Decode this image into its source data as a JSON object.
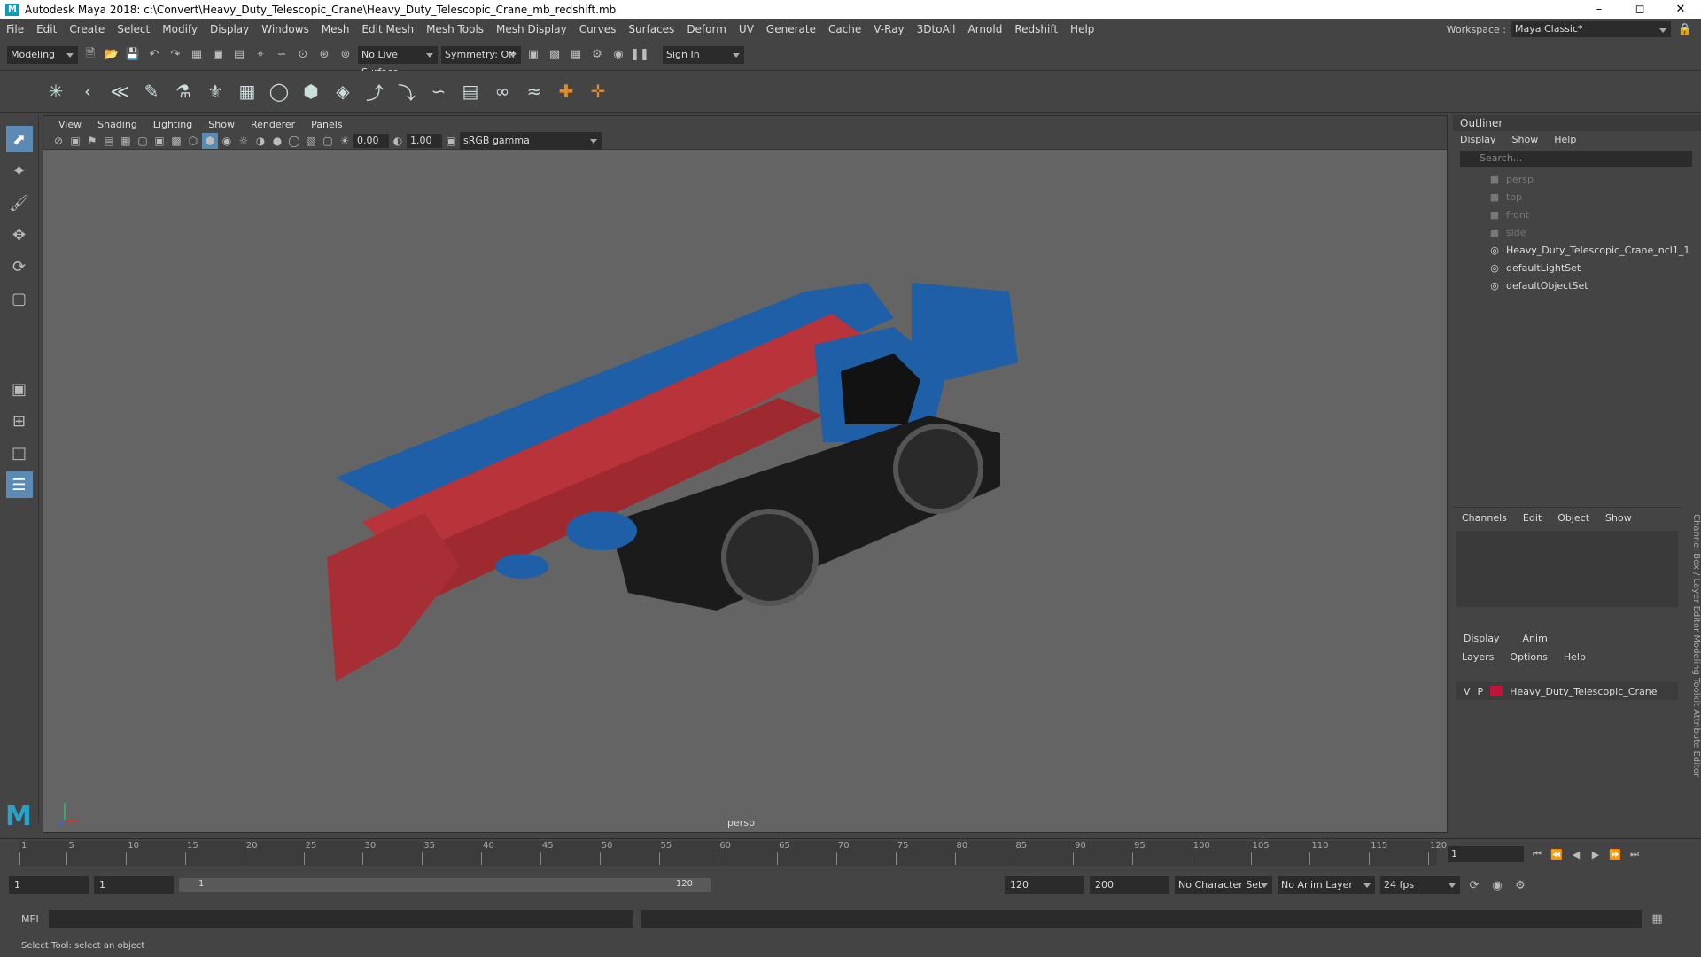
{
  "titlebar": {
    "title": "Autodesk Maya 2018: c:\\Convert\\Heavy_Duty_Telescopic_Crane\\Heavy_Duty_Telescopic_Crane_mb_redshift.mb"
  },
  "menus": [
    "File",
    "Edit",
    "Create",
    "Select",
    "Modify",
    "Display",
    "Windows",
    "Mesh",
    "Edit Mesh",
    "Mesh Tools",
    "Mesh Display",
    "Curves",
    "Surfaces",
    "Deform",
    "UV",
    "Generate",
    "Cache",
    "V-Ray",
    "3DtoAll",
    "Arnold",
    "Redshift",
    "Help"
  ],
  "workspace": {
    "label": "Workspace :",
    "value": "Maya Classic*"
  },
  "status": {
    "mode": "Modeling",
    "live_surface": "No Live Surface",
    "symmetry": "Symmetry: Off",
    "sign_in": "Sign In"
  },
  "viewport": {
    "menus": [
      "View",
      "Shading",
      "Lighting",
      "Show",
      "Renderer",
      "Panels"
    ],
    "exposure": "0.00",
    "gamma": "1.00",
    "colorspace": "sRGB gamma",
    "camera": "persp"
  },
  "outliner": {
    "title": "Outliner",
    "menus": [
      "Display",
      "Show",
      "Help"
    ],
    "search_placeholder": "Search...",
    "items": [
      {
        "label": "persp",
        "dim": true
      },
      {
        "label": "top",
        "dim": true
      },
      {
        "label": "front",
        "dim": true
      },
      {
        "label": "side",
        "dim": true
      },
      {
        "label": "Heavy_Duty_Telescopic_Crane_ncl1_1",
        "dim": false
      },
      {
        "label": "defaultLightSet",
        "dim": false
      },
      {
        "label": "defaultObjectSet",
        "dim": false
      }
    ]
  },
  "channelbox": {
    "menus": [
      "Channels",
      "Edit",
      "Object",
      "Show"
    ],
    "side_tabs": "Channel Box / Layer Editor   Modeling Toolkit   Attribute Editor"
  },
  "layers": {
    "tabs": [
      "Display",
      "Anim"
    ],
    "menus": [
      "Layers",
      "Options",
      "Help"
    ],
    "row": {
      "v": "V",
      "p": "P",
      "name": "Heavy_Duty_Telescopic_Crane"
    }
  },
  "timeline": {
    "ticks": [
      "1",
      "5",
      "10",
      "15",
      "20",
      "25",
      "30",
      "35",
      "40",
      "45",
      "50",
      "55",
      "60",
      "65",
      "70",
      "75",
      "80",
      "85",
      "90",
      "95",
      "100",
      "105",
      "110",
      "115",
      "120"
    ],
    "current": "1"
  },
  "range": {
    "start": "1",
    "start2": "1",
    "slider_lo": "1",
    "slider_hi": "120",
    "end": "120",
    "end2": "200",
    "char_set": "No Character Set",
    "anim_layer": "No Anim Layer",
    "fps": "24 fps"
  },
  "mel": {
    "label": "MEL"
  },
  "help": {
    "text": "Select Tool: select an object"
  },
  "colors": {
    "crane_red": "#b8333a",
    "crane_blue": "#1f5fa8",
    "maya_accent": "#2aa3c9"
  }
}
